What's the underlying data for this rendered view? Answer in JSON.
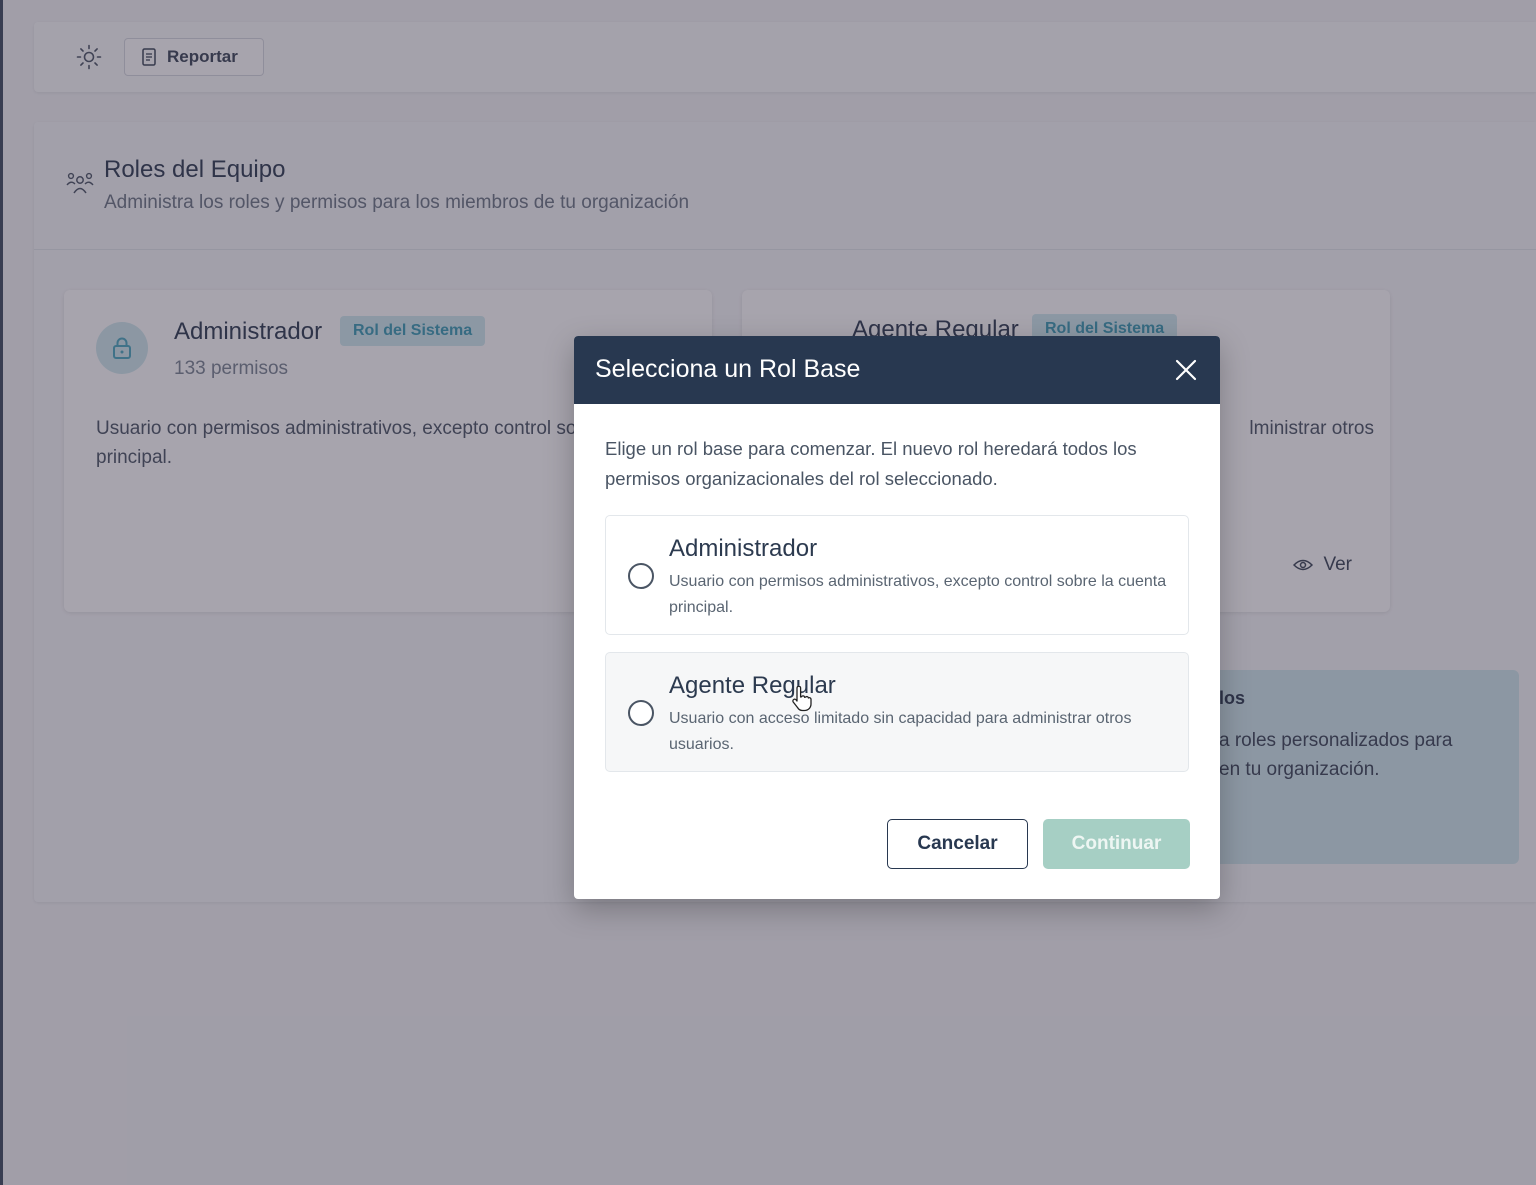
{
  "toolbar": {
    "theme_icon": "sun-icon",
    "report_icon": "document-icon",
    "report_label": "Reportar"
  },
  "page": {
    "title": "Roles del Equipo",
    "subtitle": "Administra los roles y permisos para los miembros de tu organización",
    "icon": "team-icon"
  },
  "cards": [
    {
      "title": "Administrador",
      "badge": "Rol del Sistema",
      "permissions": "133 permisos",
      "description": "Usuario con permisos administrativos, excepto control sobre la cuenta principal.",
      "icon": "lock-icon"
    },
    {
      "title": "Agente Regular",
      "badge": "Rol del Sistema",
      "description_fragment": "lministrar otros",
      "view_label": "Ver",
      "view_icon": "eye-icon"
    }
  ],
  "custom_roles": {
    "title_fragment": "los",
    "text_fragment_1": "a roles personalizados para",
    "text_fragment_2": "en tu organización."
  },
  "modal": {
    "title": "Selecciona un Rol Base",
    "intro": "Elige un rol base para comenzar. El nuevo rol heredará todos los permisos organizacionales del rol seleccionado.",
    "options": [
      {
        "title": "Administrador",
        "description": "Usuario con permisos administrativos, excepto control sobre la cuenta principal.",
        "selected": false
      },
      {
        "title": "Agente Regular",
        "description": "Usuario con acceso limitado sin capacidad para administrar otros usuarios.",
        "selected": false
      }
    ],
    "cancel_label": "Cancelar",
    "continue_label": "Continuar"
  }
}
